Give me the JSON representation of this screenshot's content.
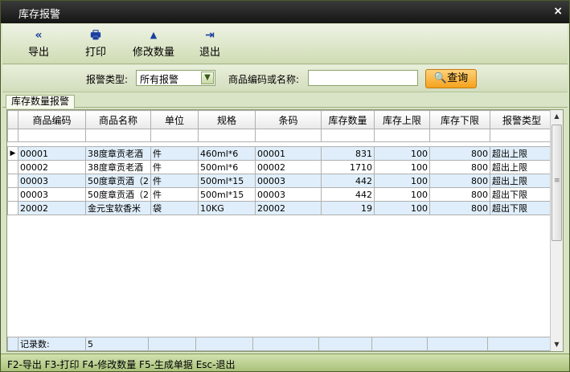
{
  "window": {
    "title": "库存报警",
    "close_glyph": "×"
  },
  "toolbar": {
    "buttons": [
      {
        "label": "导出",
        "icon": "double-left-arrow-icon",
        "glyph": "«"
      },
      {
        "label": "打印",
        "icon": "printer-icon",
        "glyph": "🖶"
      },
      {
        "label": "修改数量",
        "icon": "triangle-up-icon",
        "glyph": "▲"
      },
      {
        "label": "退出",
        "icon": "exit-door-icon",
        "glyph": "⇥"
      }
    ]
  },
  "search": {
    "alarm_type_label": "报警类型:",
    "alarm_type_value": "所有报警",
    "code_label": "商品编码或名称:",
    "code_value": "",
    "query_label": "查询",
    "query_icon": "magnifier-icon"
  },
  "tab": {
    "label": "库存数量报警"
  },
  "grid": {
    "columns": [
      "商品编码",
      "商品名称",
      "单位",
      "规格",
      "条码",
      "库存数量",
      "库存上限",
      "库存下限",
      "报警类型"
    ],
    "rows": [
      [
        "00001",
        "38度章贡老酒",
        "件",
        "460ml*6",
        "00001",
        "831",
        "100",
        "800",
        "超出上限"
      ],
      [
        "00002",
        "38度章贡老酒",
        "件",
        "500ml*6",
        "00002",
        "1710",
        "100",
        "800",
        "超出上限"
      ],
      [
        "00003",
        "50度章贡酒（2",
        "件",
        "500ml*15",
        "00003",
        "442",
        "100",
        "800",
        "超出上限"
      ],
      [
        "00003",
        "50度章贡酒（2",
        "件",
        "500ml*15",
        "00003",
        "442",
        "100",
        "800",
        "超出下限"
      ],
      [
        "20002",
        "金元宝软香米",
        "袋",
        "10KG",
        "20002",
        "19",
        "100",
        "800",
        "超出下限"
      ]
    ],
    "footer_label": "记录数:",
    "footer_count": "5"
  },
  "statusbar": {
    "text": "F2-导出 F3-打印 F4-修改数量 F5-生成单据 Esc-退出"
  },
  "colors": {
    "accent": "#f4a21c",
    "window_bg": "#d9e4c6",
    "row_alt": "#dfeefa"
  }
}
